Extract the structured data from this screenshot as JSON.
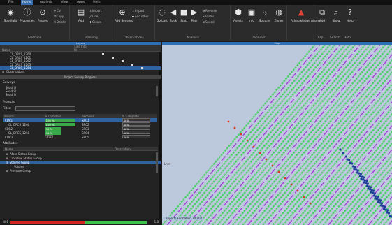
{
  "menu": [
    "File",
    "Home",
    "Analysis",
    "View",
    "Apps",
    "Help"
  ],
  "ribbon": {
    "selection": {
      "label": "Selection",
      "buttons": [
        "Spotlight",
        "Properties",
        "Passes"
      ],
      "small": [
        "Cut",
        "Copy",
        "Delete"
      ]
    },
    "planning": {
      "label": "Planning",
      "add": "Add",
      "small": [
        "Import",
        "Line",
        "Create"
      ],
      "obs_add": "Add Sensors",
      "obs_small": [
        "Import",
        "Add other"
      ]
    },
    "observations_label": "Observations",
    "analysis": {
      "label": "Analysis",
      "buttons": [
        "Go Last",
        "Back",
        "Stop",
        "Play"
      ],
      "small": [
        "Reverse",
        "Faster",
        "Speed"
      ]
    },
    "definition": {
      "label": "Definition",
      "buttons": [
        "Assets",
        "Info",
        "Sources",
        "Zones"
      ]
    },
    "alarms": {
      "buttons": [
        "Acknowledge Alarms"
      ]
    },
    "display": {
      "labels": [
        "Disp...",
        "Search",
        "Help"
      ],
      "buttons": [
        "Add",
        "Show",
        "Help"
      ]
    }
  },
  "left_panel": {
    "header": "Layers",
    "sub_header": "Line Info",
    "columns": [
      "Name",
      "Id"
    ],
    "lines": [
      "CL_DRCS_1260",
      "CL_DRCS_1261",
      "CL_DRCS_1262",
      "CL_DRCS_1263",
      "CL_DRCS_1264"
    ],
    "observations": "Observations",
    "survey_section": "Project Survey Progress",
    "surveys_label": "Surveys",
    "survey_items": [
      "Seadrill",
      "Seadrill",
      "Seadrill"
    ],
    "projects_label": "Projects",
    "filter_label": "Filter:",
    "filter_value": "",
    "progress_columns": [
      "Source",
      "% Complete",
      "Receiver",
      "% Complete"
    ],
    "progress_rows": [
      {
        "source": "CDR1",
        "pct": "100 %",
        "receiver": "SRC1",
        "rpct": "0 %",
        "sel": true,
        "fill": 1.0
      },
      {
        "source": "CL_DRCS_1260",
        "pct": "100 %",
        "receiver": "SRC2",
        "rpct": "0 %",
        "sel": false,
        "fill": 1.0
      },
      {
        "source": "CDR2",
        "pct": "54 %",
        "receiver": "SRC3",
        "rpct": "0 %",
        "sel": false,
        "fill": 0.54
      },
      {
        "source": "CL_DRCS_1261",
        "pct": "54 %",
        "receiver": "SRC4",
        "rpct": "0 %",
        "sel": false,
        "fill": 0.54
      },
      {
        "source": "CDR3",
        "pct": "0 %",
        "receiver": "SRC5",
        "rpct": "0 %",
        "sel": false,
        "fill": 0.0
      }
    ],
    "attributes_label": "Attributes",
    "attr_columns": [
      "Name",
      "Description"
    ],
    "attr_items": [
      "Afore Status Group",
      "Crossline Status Group",
      "Volume Group",
      "Volume",
      "Pressure Group"
    ],
    "footer_min": "-401",
    "footer_max": "1.0",
    "footer_bar_fraction": 0.55
  },
  "map": {
    "header": "Map",
    "label_left": "Lhrd",
    "label_bottom": "Reports Formation 300/07",
    "colors": {
      "bg": "#bcc8dc",
      "green": "#4fd06a",
      "purple": "#a23fd8",
      "blue": "#1f3f9a",
      "red": "#d63b24"
    }
  }
}
